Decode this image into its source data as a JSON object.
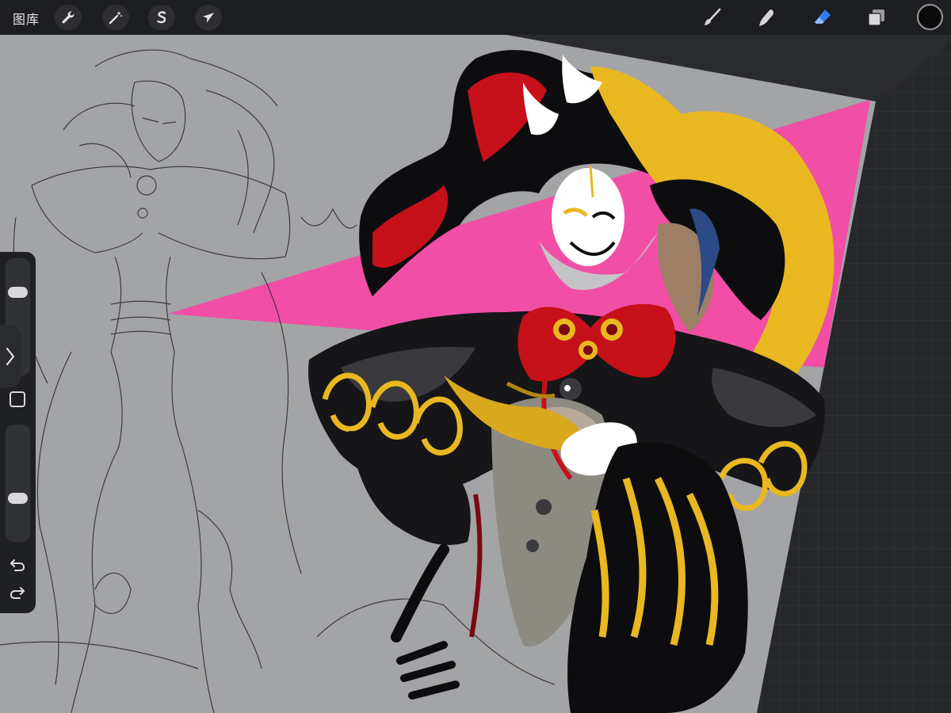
{
  "topbar": {
    "gallery_label": "图库",
    "left_tools": [
      {
        "name": "actions",
        "icon": "wrench-icon"
      },
      {
        "name": "adjustments",
        "icon": "magic-wand-icon"
      },
      {
        "name": "selection",
        "icon": "selection-s-icon"
      },
      {
        "name": "transform",
        "icon": "arrow-cursor-icon"
      }
    ],
    "right_tools": [
      {
        "name": "brush",
        "icon": "brush-icon"
      },
      {
        "name": "smudge",
        "icon": "smudge-finger-icon"
      },
      {
        "name": "eraser",
        "icon": "eraser-icon",
        "active": true
      },
      {
        "name": "layers",
        "icon": "layers-icon"
      }
    ],
    "current_color": "#0b0b0c",
    "active_tool_color": "#2f7cf6"
  },
  "sidebar": {
    "brush_size_level": 0.25,
    "opacity_level": 0.65,
    "modify_icon": "square-icon",
    "undo_icon": "undo-arrow-icon",
    "redo_icon": "redo-arrow-icon",
    "toggle_icon": "chevron-right-icon"
  },
  "canvas": {
    "background_color": "#a3a4a6",
    "artwork_palette": [
      "#f14fa5",
      "#e9b820",
      "#c6101a",
      "#0d0d0f",
      "#ffffff",
      "#9d7e66"
    ]
  }
}
